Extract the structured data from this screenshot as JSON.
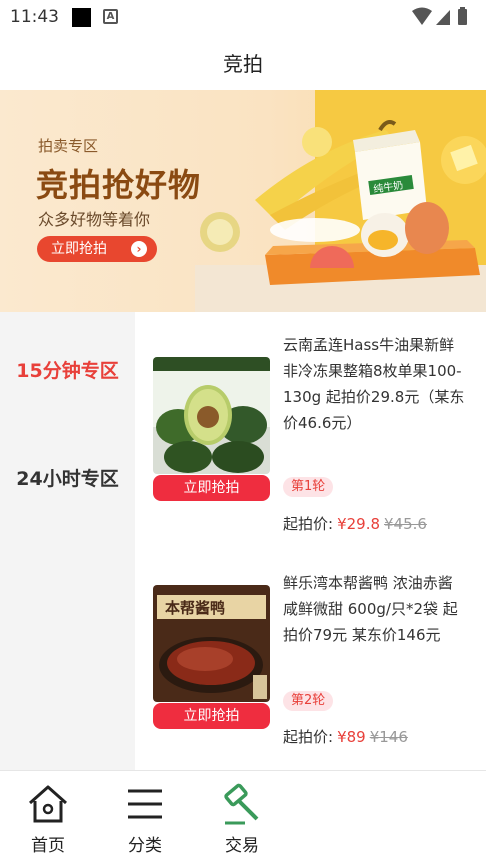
{
  "status_bar": {
    "time": "11:43",
    "notif_letter": "A"
  },
  "header": {
    "title": "竞拍"
  },
  "banner": {
    "subtitle": "拍卖专区",
    "title": "竞拍抢好物",
    "desc": "众多好物等着你",
    "button_label": "立即抢拍",
    "milk_box_text": "纯牛奶"
  },
  "sidebar": {
    "items": [
      {
        "label": "15分钟专区",
        "active": true
      },
      {
        "label": "24小时专区",
        "active": false
      }
    ]
  },
  "products": [
    {
      "name": "云南孟连Hass牛油果新鲜非冷冻果整箱8枚单果100-130g 起拍价29.8元（某东价46.6元）",
      "round": "第1轮",
      "price_label": "起拍价:",
      "price": "¥29.8",
      "original_price": "¥45.6",
      "button_label": "立即抢拍"
    },
    {
      "name": "鲜乐湾本帮酱鸭 浓油赤酱 咸鲜微甜 600g/只*2袋 起拍价79元 某东价146元",
      "round": "第2轮",
      "price_label": "起拍价:",
      "price": "¥89",
      "original_price": "¥146",
      "button_label": "立即抢拍",
      "package_text": "本帮酱鸭"
    }
  ],
  "bottom_nav": [
    {
      "label": "首页",
      "icon": "home-icon"
    },
    {
      "label": "分类",
      "icon": "menu-list-icon"
    },
    {
      "label": "交易",
      "icon": "auction-hammer-icon"
    }
  ],
  "colors": {
    "accent": "#e8403a",
    "button_red": "#ef2d3f",
    "nav_green": "#3a9a5a"
  }
}
